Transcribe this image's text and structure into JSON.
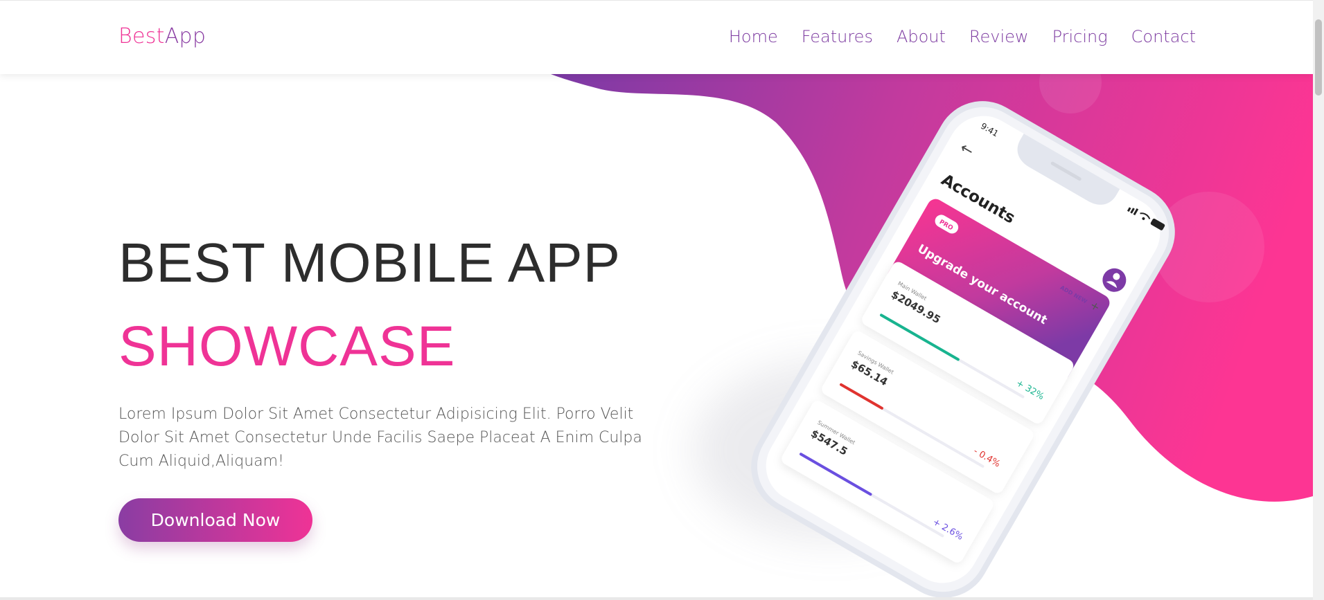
{
  "brand": {
    "part1": "Best",
    "part2": "App"
  },
  "nav": [
    {
      "label": "Home"
    },
    {
      "label": "Features"
    },
    {
      "label": "About"
    },
    {
      "label": "Review"
    },
    {
      "label": "Pricing"
    },
    {
      "label": "Contact"
    }
  ],
  "hero": {
    "title": "BEST MOBILE APP",
    "subtitle": "SHOWCASE",
    "description": "Lorem Ipsum Dolor Sit Amet Consectetur Adipisicing Elit. Porro Velit Dolor Sit Amet Consectetur Unde Facilis Saepe Placeat A Enim Culpa Cum Aliquid,Aliquam!",
    "cta": "Download Now"
  },
  "phone": {
    "time": "9:41",
    "back_icon": "back-arrow-icon",
    "screen_title": "Accounts",
    "promo": {
      "badge": "PRO",
      "text": "Upgrade your account",
      "add_new": "ADD NEW",
      "add_icon": "plus-icon",
      "arrow_icon": "right-arrow-icon"
    },
    "wallets": [
      {
        "name": "Main Wallet",
        "amount": "$2049.95",
        "change": "+ 32%",
        "progress": 0.55,
        "color": "#18b48f"
      },
      {
        "name": "Savings Wallet",
        "amount": "$65.14",
        "change": "- 0.4%",
        "progress": 0.3,
        "color": "#e0332f"
      },
      {
        "name": "Summer Wallet",
        "amount": "$547.5",
        "change": "+ 2.6%",
        "progress": 0.5,
        "color": "#6a4fe0"
      }
    ]
  },
  "colors": {
    "brand_pink": "#ef3396",
    "brand_purple": "#8a3da3",
    "text_dark": "#2d2d2d"
  }
}
